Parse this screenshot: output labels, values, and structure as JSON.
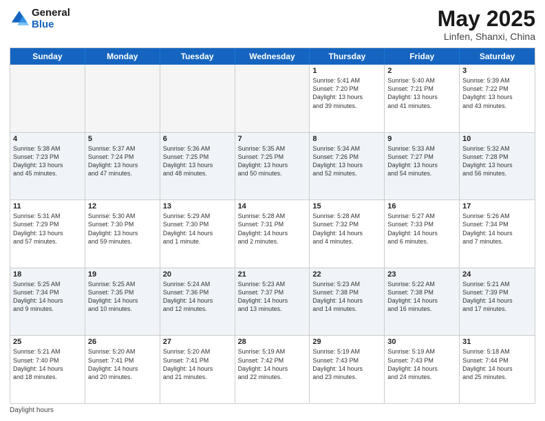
{
  "logo": {
    "line1": "General",
    "line2": "Blue"
  },
  "title": "May 2025",
  "subtitle": "Linfen, Shanxi, China",
  "days_of_week": [
    "Sunday",
    "Monday",
    "Tuesday",
    "Wednesday",
    "Thursday",
    "Friday",
    "Saturday"
  ],
  "footer": "Daylight hours",
  "weeks": [
    [
      {
        "day": "",
        "info": ""
      },
      {
        "day": "",
        "info": ""
      },
      {
        "day": "",
        "info": ""
      },
      {
        "day": "",
        "info": ""
      },
      {
        "day": "1",
        "info": "Sunrise: 5:41 AM\nSunset: 7:20 PM\nDaylight: 13 hours\nand 39 minutes."
      },
      {
        "day": "2",
        "info": "Sunrise: 5:40 AM\nSunset: 7:21 PM\nDaylight: 13 hours\nand 41 minutes."
      },
      {
        "day": "3",
        "info": "Sunrise: 5:39 AM\nSunset: 7:22 PM\nDaylight: 13 hours\nand 43 minutes."
      }
    ],
    [
      {
        "day": "4",
        "info": "Sunrise: 5:38 AM\nSunset: 7:23 PM\nDaylight: 13 hours\nand 45 minutes."
      },
      {
        "day": "5",
        "info": "Sunrise: 5:37 AM\nSunset: 7:24 PM\nDaylight: 13 hours\nand 47 minutes."
      },
      {
        "day": "6",
        "info": "Sunrise: 5:36 AM\nSunset: 7:25 PM\nDaylight: 13 hours\nand 48 minutes."
      },
      {
        "day": "7",
        "info": "Sunrise: 5:35 AM\nSunset: 7:25 PM\nDaylight: 13 hours\nand 50 minutes."
      },
      {
        "day": "8",
        "info": "Sunrise: 5:34 AM\nSunset: 7:26 PM\nDaylight: 13 hours\nand 52 minutes."
      },
      {
        "day": "9",
        "info": "Sunrise: 5:33 AM\nSunset: 7:27 PM\nDaylight: 13 hours\nand 54 minutes."
      },
      {
        "day": "10",
        "info": "Sunrise: 5:32 AM\nSunset: 7:28 PM\nDaylight: 13 hours\nand 56 minutes."
      }
    ],
    [
      {
        "day": "11",
        "info": "Sunrise: 5:31 AM\nSunset: 7:29 PM\nDaylight: 13 hours\nand 57 minutes."
      },
      {
        "day": "12",
        "info": "Sunrise: 5:30 AM\nSunset: 7:30 PM\nDaylight: 13 hours\nand 59 minutes."
      },
      {
        "day": "13",
        "info": "Sunrise: 5:29 AM\nSunset: 7:30 PM\nDaylight: 14 hours\nand 1 minute."
      },
      {
        "day": "14",
        "info": "Sunrise: 5:28 AM\nSunset: 7:31 PM\nDaylight: 14 hours\nand 2 minutes."
      },
      {
        "day": "15",
        "info": "Sunrise: 5:28 AM\nSunset: 7:32 PM\nDaylight: 14 hours\nand 4 minutes."
      },
      {
        "day": "16",
        "info": "Sunrise: 5:27 AM\nSunset: 7:33 PM\nDaylight: 14 hours\nand 6 minutes."
      },
      {
        "day": "17",
        "info": "Sunrise: 5:26 AM\nSunset: 7:34 PM\nDaylight: 14 hours\nand 7 minutes."
      }
    ],
    [
      {
        "day": "18",
        "info": "Sunrise: 5:25 AM\nSunset: 7:34 PM\nDaylight: 14 hours\nand 9 minutes."
      },
      {
        "day": "19",
        "info": "Sunrise: 5:25 AM\nSunset: 7:35 PM\nDaylight: 14 hours\nand 10 minutes."
      },
      {
        "day": "20",
        "info": "Sunrise: 5:24 AM\nSunset: 7:36 PM\nDaylight: 14 hours\nand 12 minutes."
      },
      {
        "day": "21",
        "info": "Sunrise: 5:23 AM\nSunset: 7:37 PM\nDaylight: 14 hours\nand 13 minutes."
      },
      {
        "day": "22",
        "info": "Sunrise: 5:23 AM\nSunset: 7:38 PM\nDaylight: 14 hours\nand 14 minutes."
      },
      {
        "day": "23",
        "info": "Sunrise: 5:22 AM\nSunset: 7:38 PM\nDaylight: 14 hours\nand 16 minutes."
      },
      {
        "day": "24",
        "info": "Sunrise: 5:21 AM\nSunset: 7:39 PM\nDaylight: 14 hours\nand 17 minutes."
      }
    ],
    [
      {
        "day": "25",
        "info": "Sunrise: 5:21 AM\nSunset: 7:40 PM\nDaylight: 14 hours\nand 18 minutes."
      },
      {
        "day": "26",
        "info": "Sunrise: 5:20 AM\nSunset: 7:41 PM\nDaylight: 14 hours\nand 20 minutes."
      },
      {
        "day": "27",
        "info": "Sunrise: 5:20 AM\nSunset: 7:41 PM\nDaylight: 14 hours\nand 21 minutes."
      },
      {
        "day": "28",
        "info": "Sunrise: 5:19 AM\nSunset: 7:42 PM\nDaylight: 14 hours\nand 22 minutes."
      },
      {
        "day": "29",
        "info": "Sunrise: 5:19 AM\nSunset: 7:43 PM\nDaylight: 14 hours\nand 23 minutes."
      },
      {
        "day": "30",
        "info": "Sunrise: 5:19 AM\nSunset: 7:43 PM\nDaylight: 14 hours\nand 24 minutes."
      },
      {
        "day": "31",
        "info": "Sunrise: 5:18 AM\nSunset: 7:44 PM\nDaylight: 14 hours\nand 25 minutes."
      }
    ]
  ]
}
